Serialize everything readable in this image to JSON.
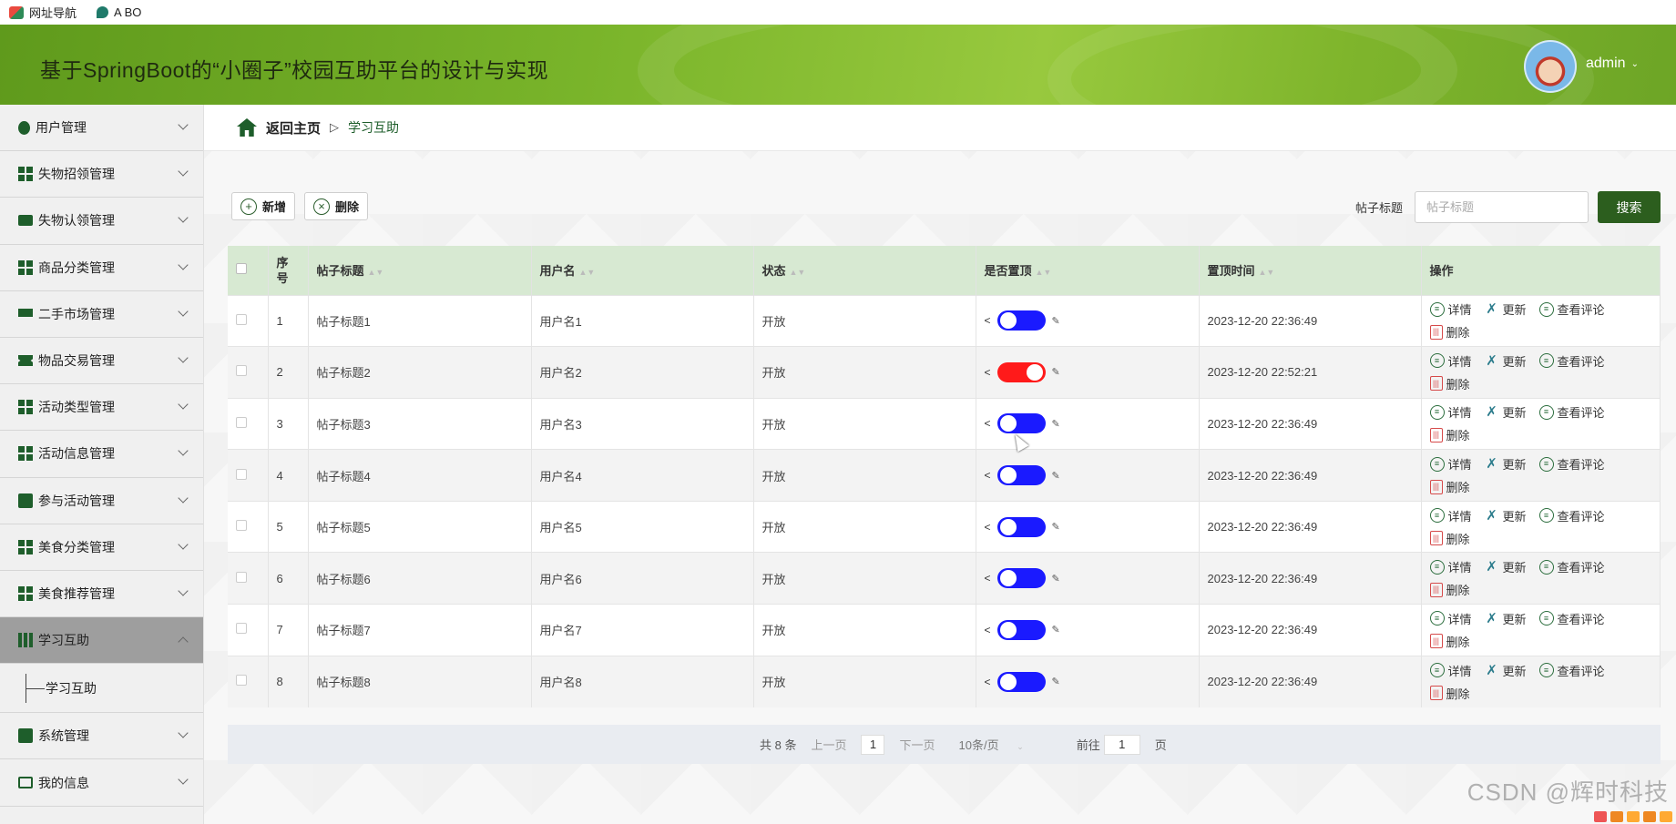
{
  "bookmarks": [
    "网址导航",
    "A BO"
  ],
  "header": {
    "title": "基于SpringBoot的“小圈子”校园互助平台的设计与实现",
    "user": "admin"
  },
  "sidebar": {
    "items": [
      {
        "label": "用户管理",
        "icon": "dot"
      },
      {
        "label": "失物招领管理",
        "icon": "grid"
      },
      {
        "label": "失物认领管理",
        "icon": "wallet"
      },
      {
        "label": "商品分类管理",
        "icon": "grid"
      },
      {
        "label": "二手市场管理",
        "icon": "monitor"
      },
      {
        "label": "物品交易管理",
        "icon": "ticket"
      },
      {
        "label": "活动类型管理",
        "icon": "grid"
      },
      {
        "label": "活动信息管理",
        "icon": "grid"
      },
      {
        "label": "参与活动管理",
        "icon": "check"
      },
      {
        "label": "美食分类管理",
        "icon": "grid"
      },
      {
        "label": "美食推荐管理",
        "icon": "grid"
      },
      {
        "label": "学习互助",
        "icon": "books",
        "active": true
      },
      {
        "label": "系统管理",
        "icon": "xbox"
      },
      {
        "label": "我的信息",
        "icon": "card"
      }
    ],
    "sub_item": "学习互助"
  },
  "breadcrumb": {
    "home": "返回主页",
    "current": "学习互助"
  },
  "toolbar": {
    "add": "新增",
    "delete": "删除",
    "search_label": "帖子标题",
    "search_placeholder": "帖子标题",
    "search_button": "搜索"
  },
  "table": {
    "headers": {
      "seq": "序号",
      "title": "帖子标题",
      "username": "用户名",
      "status": "状态",
      "pinned": "是否置顶",
      "pin_time": "置顶时间",
      "actions": "操作"
    },
    "rows": [
      {
        "seq": "1",
        "title": "帖子标题1",
        "username": "用户名1",
        "status": "开放",
        "pinned": false,
        "pin_time": "2023-12-20 22:36:49"
      },
      {
        "seq": "2",
        "title": "帖子标题2",
        "username": "用户名2",
        "status": "开放",
        "pinned": true,
        "pin_time": "2023-12-20 22:52:21"
      },
      {
        "seq": "3",
        "title": "帖子标题3",
        "username": "用户名3",
        "status": "开放",
        "pinned": false,
        "pin_time": "2023-12-20 22:36:49"
      },
      {
        "seq": "4",
        "title": "帖子标题4",
        "username": "用户名4",
        "status": "开放",
        "pinned": false,
        "pin_time": "2023-12-20 22:36:49"
      },
      {
        "seq": "5",
        "title": "帖子标题5",
        "username": "用户名5",
        "status": "开放",
        "pinned": false,
        "pin_time": "2023-12-20 22:36:49"
      },
      {
        "seq": "6",
        "title": "帖子标题6",
        "username": "用户名6",
        "status": "开放",
        "pinned": false,
        "pin_time": "2023-12-20 22:36:49"
      },
      {
        "seq": "7",
        "title": "帖子标题7",
        "username": "用户名7",
        "status": "开放",
        "pinned": false,
        "pin_time": "2023-12-20 22:36:49"
      },
      {
        "seq": "8",
        "title": "帖子标题8",
        "username": "用户名8",
        "status": "开放",
        "pinned": false,
        "pin_time": "2023-12-20 22:36:49"
      }
    ],
    "actions": {
      "detail": "详情",
      "update": "更新",
      "comments": "查看评论",
      "delete": "删除"
    }
  },
  "pagination": {
    "total": "共 8 条",
    "prev": "上一页",
    "current_page": "1",
    "next": "下一页",
    "page_size": "10条/页",
    "goto_label": "前往",
    "goto_value": "1",
    "page_suffix": "页"
  },
  "watermark": "CSDN @辉时科技",
  "colors": {
    "header_green": "#79b42a",
    "dark_green": "#2c5e1e",
    "table_header": "#d7e9d2",
    "toggle_off": "#1a1aff",
    "toggle_on": "#ff1a1a"
  }
}
